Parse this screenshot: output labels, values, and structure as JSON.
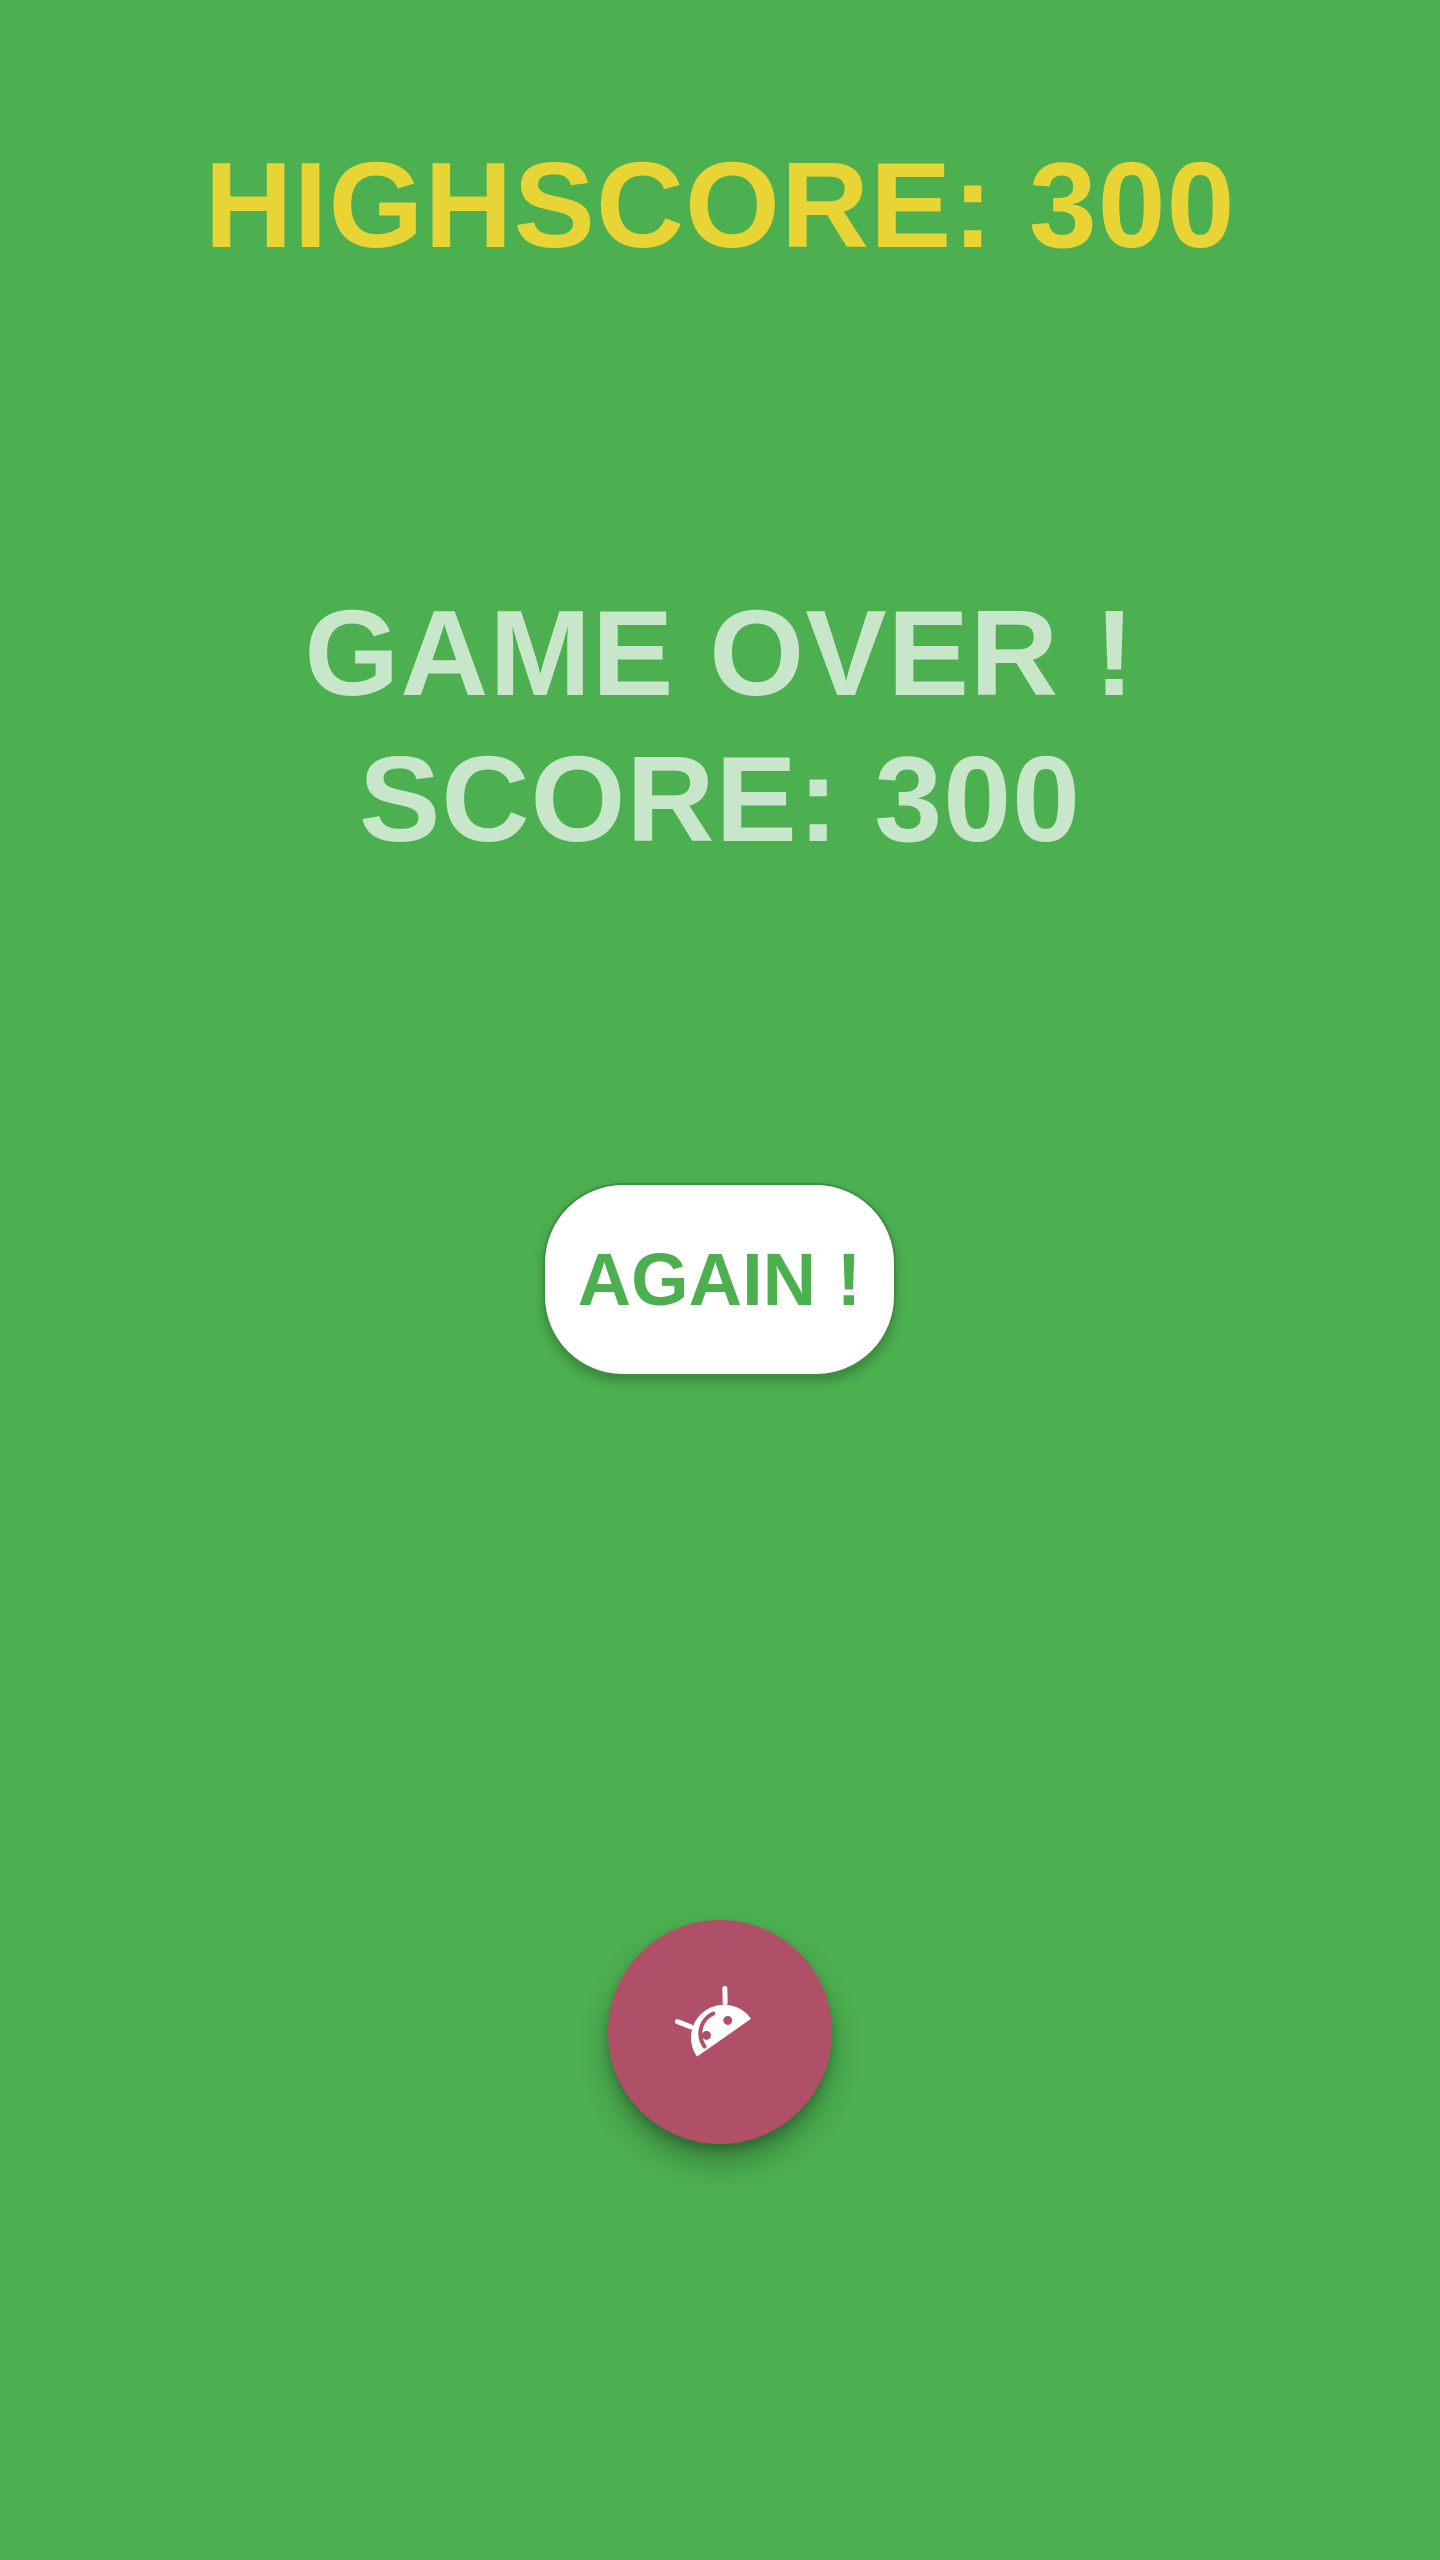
{
  "header": {
    "highscore_text": "HIGHSCORE: 300"
  },
  "result": {
    "game_over_text": "GAME OVER !",
    "score_text": "SCORE: 300"
  },
  "buttons": {
    "again_label": "AGAIN !",
    "fab_icon": "android-robot-icon"
  },
  "colors": {
    "background": "#4caf50",
    "highscore": "#e8d535",
    "result_text": "#c8e6c9",
    "button_bg": "#ffffff",
    "button_text": "#4caf50",
    "fab_bg": "#b04f68"
  }
}
